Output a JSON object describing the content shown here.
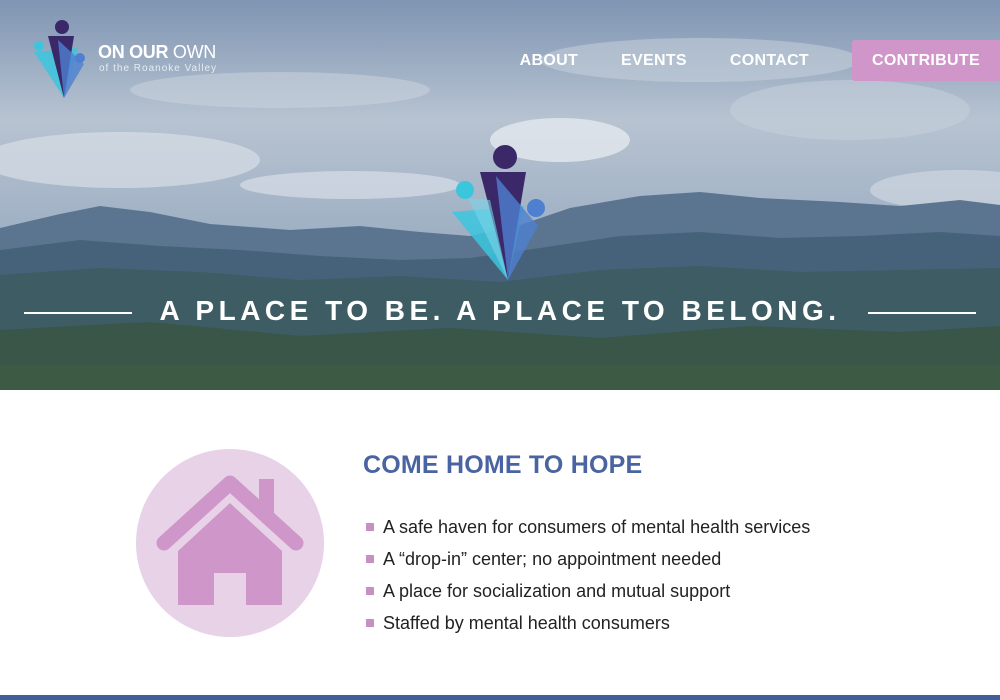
{
  "brand": {
    "title_bold": "ON OUR",
    "title_light": "OWN",
    "subtitle": "of the Roanoke Valley"
  },
  "nav": {
    "items": [
      {
        "label": "ABOUT"
      },
      {
        "label": "EVENTS"
      },
      {
        "label": "CONTACT"
      }
    ],
    "contribute_label": "CONTRIBUTE"
  },
  "hero": {
    "tagline": "A PLACE TO BE. A PLACE TO BELONG."
  },
  "hope": {
    "icon": "house-icon",
    "heading": "COME HOME TO HOPE",
    "items": [
      "A safe haven for consumers of mental health services",
      "A “drop-in” center; no appointment needed",
      "A place for socialization and mutual support",
      "Staffed by mental health consumers"
    ]
  },
  "colors": {
    "accent_pink": "#d096c9",
    "heading_blue": "#4a64a2",
    "icon_circle": "#e8d2e8",
    "icon_fill": "#cf97c9",
    "logo_navy": "#3a2868",
    "logo_cyan": "#3cc6de",
    "logo_blue": "#4f7fd0"
  }
}
